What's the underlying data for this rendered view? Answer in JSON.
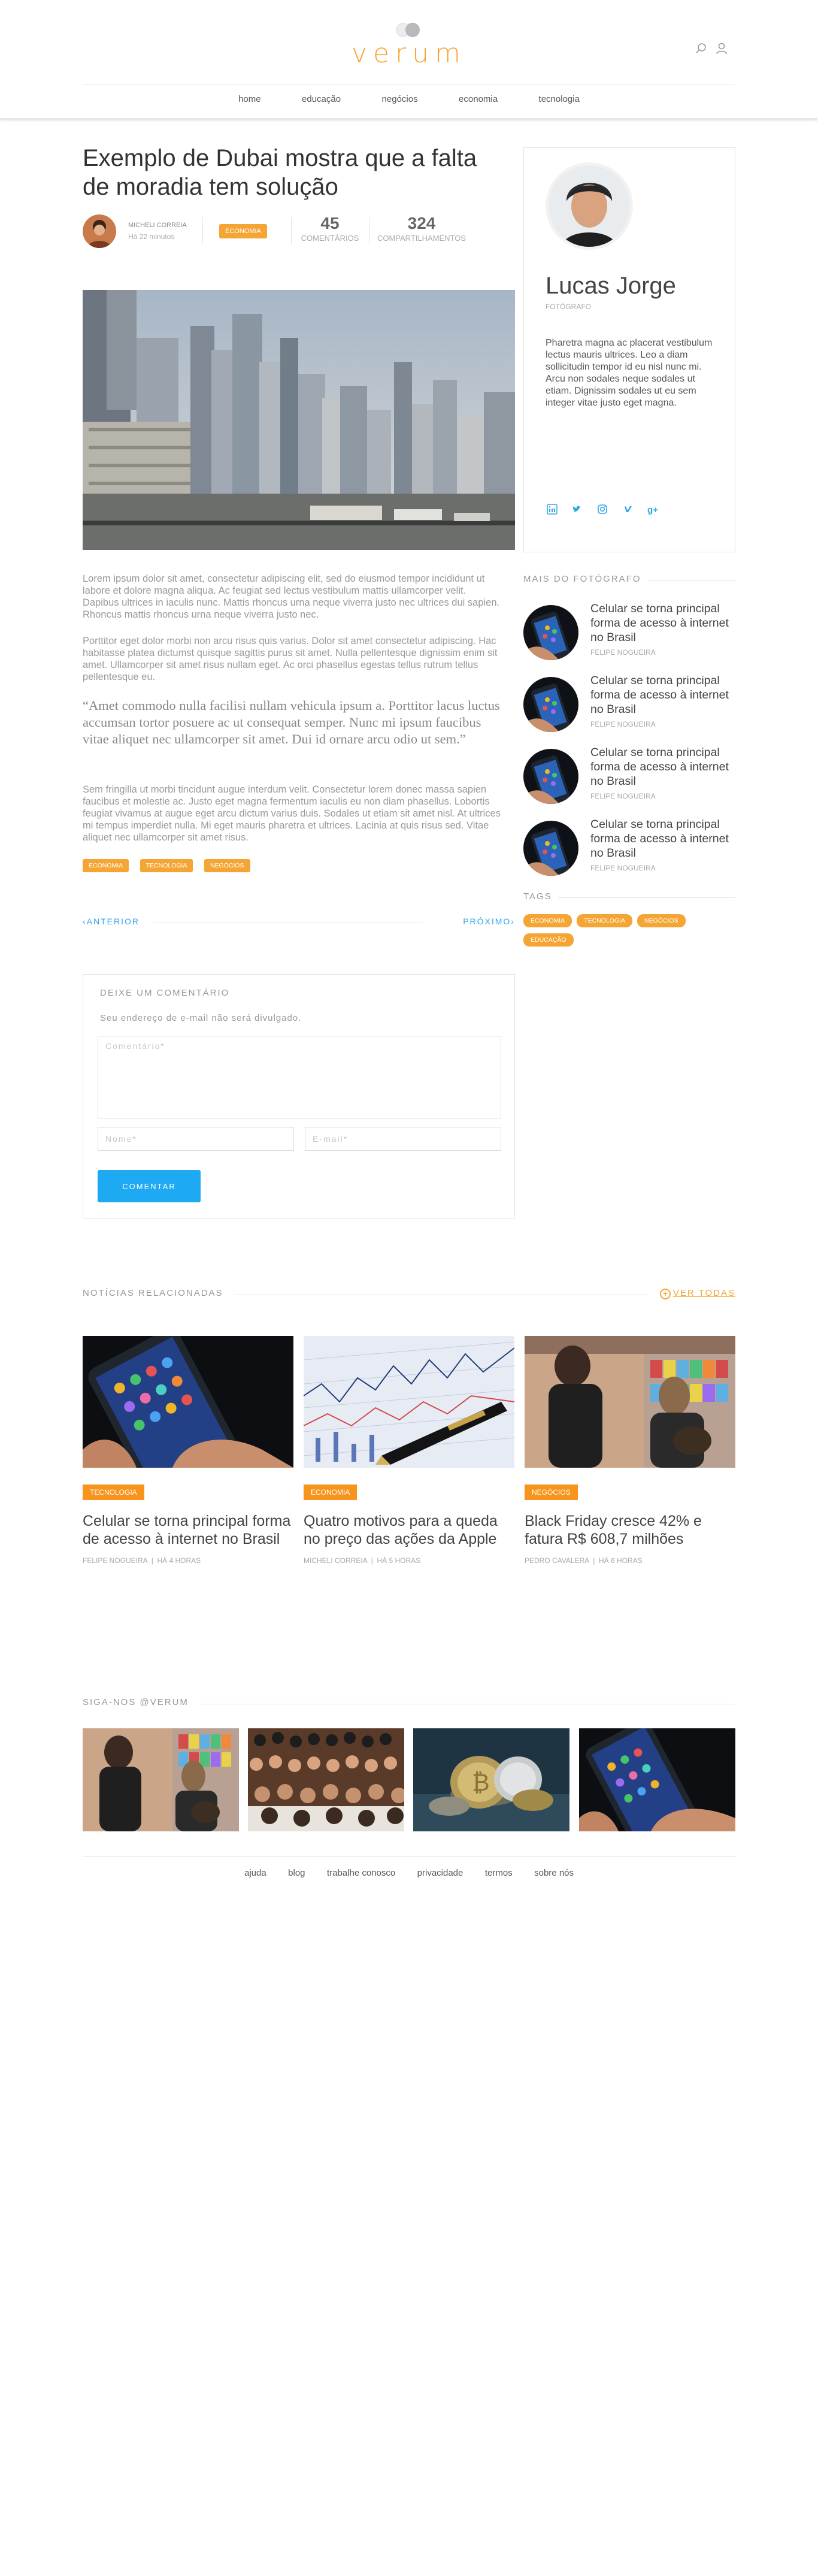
{
  "header": {
    "logo_text": "verum",
    "nav": [
      "home",
      "educação",
      "negócios",
      "economia",
      "tecnologia"
    ],
    "icons": [
      "search-icon",
      "user-icon"
    ]
  },
  "article": {
    "title": "Exemplo de Dubai mostra que a falta de moradia tem solução",
    "author": "MICHELI CORREIA",
    "time_ago": "Há 22 minutos",
    "category": "ECONOMIA",
    "comments_count": "45",
    "comments_label": "COMENTÁRIOS",
    "shares_count": "324",
    "shares_label": "COMPARTILHAMENTOS",
    "paragraphs": [
      "Lorem ipsum dolor sit amet, consectetur adipiscing elit, sed do eiusmod tempor incididunt ut labore et dolore magna aliqua. Ac feugiat sed lectus vestibulum mattis ullamcorper velit. Dapibus ultrices in iaculis nunc. Mattis rhoncus urna neque viverra justo nec ultrices dui sapien. Rhoncus mattis rhoncus urna neque viverra justo nec.",
      "Porttitor eget dolor morbi non arcu risus quis varius. Dolor sit amet consectetur adipiscing. Hac habitasse platea dictumst quisque sagittis purus sit amet. Nulla pellentesque dignissim enim sit amet. Ullamcorper sit amet risus nullam eget. Ac orci phasellus egestas tellus rutrum tellus pellentesque eu.",
      "Sem fringilla ut morbi tincidunt augue interdum velit. Consectetur lorem donec massa sapien faucibus et molestie ac. Justo eget magna fermentum iaculis eu non diam phasellus. Lobortis feugiat vivamus at augue eget arcu dictum varius duis. Sodales ut etiam sit amet nisl. At ultrices mi tempus imperdiet nulla. Mi eget mauris pharetra et ultrices. Lacinia at quis risus sed. Vitae aliquet nec ullamcorper sit amet risus."
    ],
    "quote": "“Amet commodo nulla facilisi nullam vehicula ipsum a. Porttitor lacus luctus accumsan tortor posuere ac ut consequat semper. Nunc mi ipsum faucibus vitae aliquet nec ullamcorper sit amet. Dui id ornare arcu odio ut sem.”",
    "tags": [
      "ECONOMIA",
      "TECNOLOGIA",
      "NEGÓCIOS"
    ],
    "prev_label": "ANTERIOR",
    "next_label": "PRÓXIMO"
  },
  "comment_form": {
    "title": "DEIXE UM COMENTÁRIO",
    "subtitle": "Seu endereço de e-mail não será divulgado.",
    "comment_placeholder": "Comentário*",
    "name_placeholder": "Nome*",
    "email_placeholder": "E-mail*",
    "submit_label": "COMENTAR"
  },
  "sidebar": {
    "profile": {
      "name": "Lucas Jorge",
      "role": "FOTÓGRAFO",
      "bio": "Pharetra magna ac placerat vestibulum lectus mauris ultrices. Leo a diam sollicitudin tempor id eu nisl nunc mi. Arcu non sodales neque sodales ut etiam. Dignissim sodales ut eu sem integer vitae justo eget magna.",
      "social": [
        "linkedin-icon",
        "twitter-icon",
        "instagram-icon",
        "vimeo-icon",
        "google-plus-icon"
      ]
    },
    "more_heading": "MAIS DO FOTÓGRAFO",
    "more_items": [
      {
        "title": "Celular se torna principal forma de acesso à internet no Brasil",
        "author": "FELIPE NOGUEIRA"
      },
      {
        "title": "Celular se torna principal forma de acesso à internet no Brasil",
        "author": "FELIPE NOGUEIRA"
      },
      {
        "title": "Celular se torna principal forma de acesso à internet no Brasil",
        "author": "FELIPE NOGUEIRA"
      },
      {
        "title": "Celular se torna principal forma de acesso à internet no Brasil",
        "author": "FELIPE NOGUEIRA"
      }
    ],
    "tags_heading": "TAGS",
    "tags": [
      "ECONOMIA",
      "TECNOLOGIA",
      "NEGÓCIOS",
      "EDUCAÇÃO"
    ]
  },
  "related": {
    "heading": "NOTÍCIAS RELACIONADAS",
    "see_all": "VER TODAS",
    "cards": [
      {
        "category": "TECNOLOGIA",
        "title": "Celular se torna principal forma de acesso à internet no Brasil",
        "author": "FELIPE NOGUEIRA",
        "time": "HÁ 4 HORAS"
      },
      {
        "category": "ECONOMIA",
        "title": "Quatro motivos para a queda no preço das ações da Apple",
        "author": "MICHELI CORREIA",
        "time": "HÁ 5 HORAS"
      },
      {
        "category": "NEGÓCIOS",
        "title": "Black Friday cresce 42% e fatura R$ 608,7 milhões",
        "author": "PEDRO CAVALERA",
        "time": "HÁ 6 HORAS"
      }
    ]
  },
  "instagram": {
    "heading": "SIGA-NOS @VERUM"
  },
  "footer": {
    "links": [
      "ajuda",
      "blog",
      "trabalhe conosco",
      "privacidade",
      "termos",
      "sobre nós"
    ]
  },
  "colors": {
    "accent_orange": "#f5a534",
    "accent_blue": "#1ea9f3"
  }
}
